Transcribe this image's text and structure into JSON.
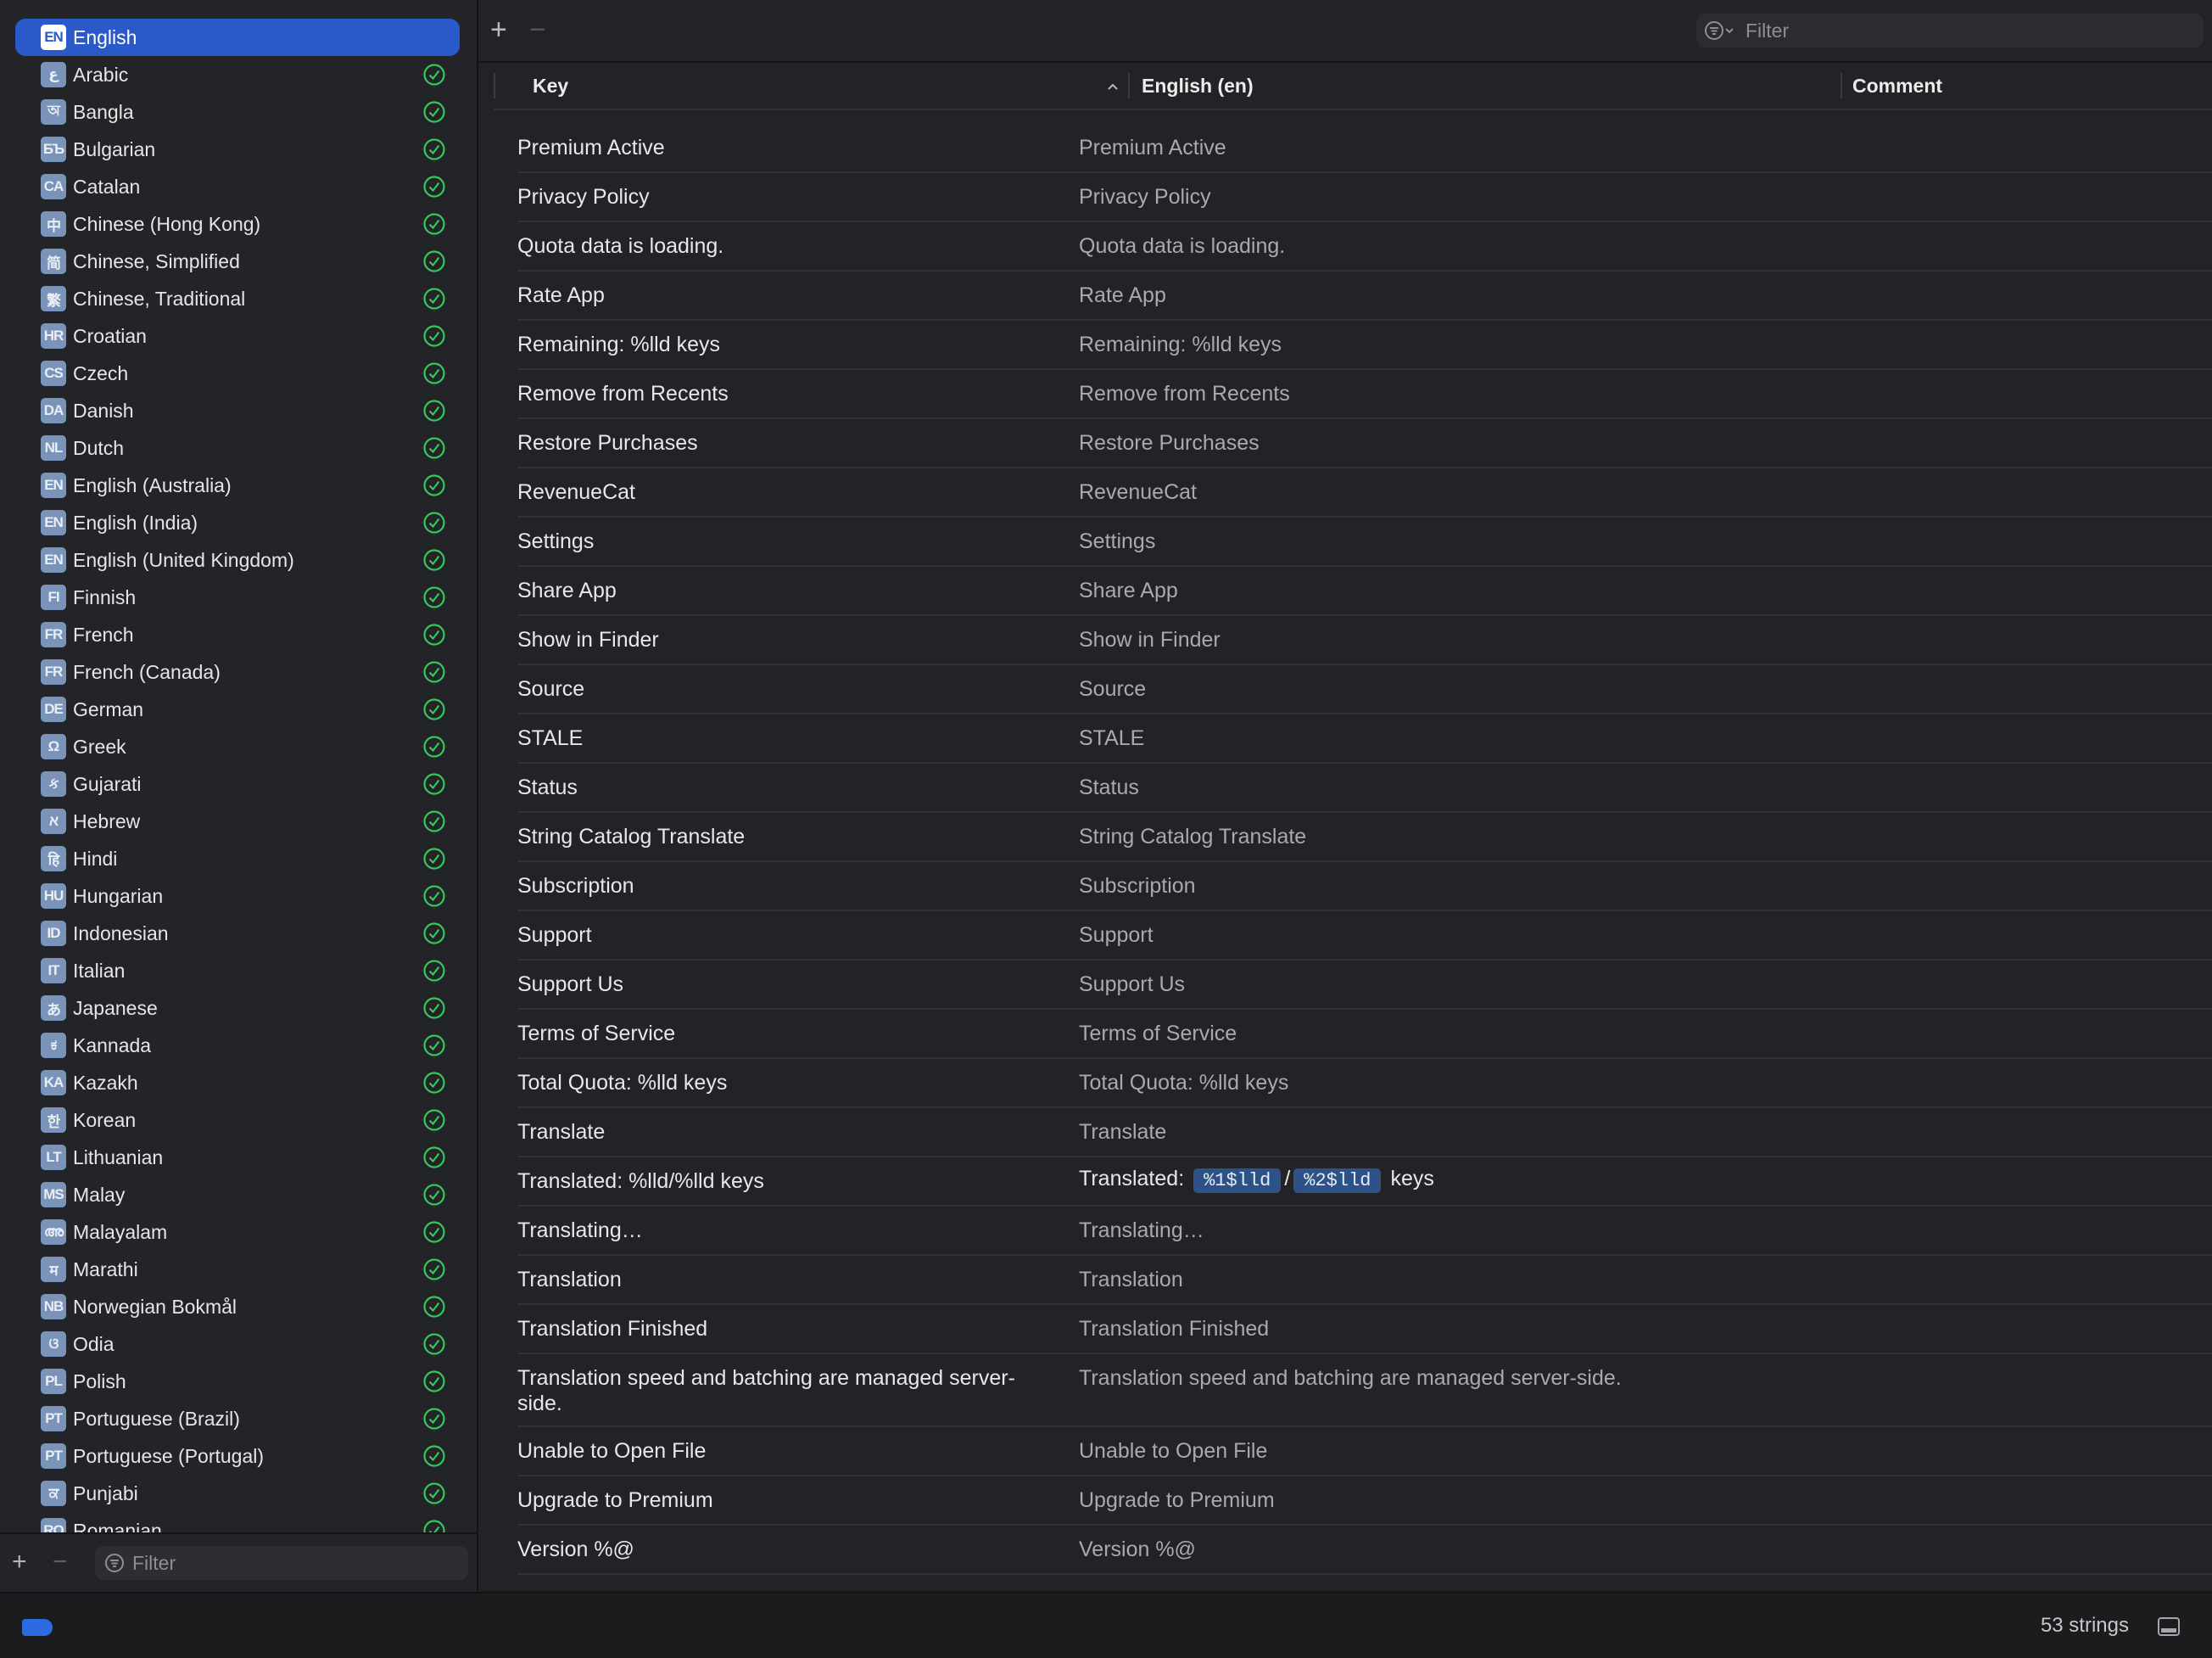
{
  "sidebar": {
    "languages": [
      {
        "code": "EN",
        "name": "English",
        "selected": true,
        "complete": false
      },
      {
        "code": "ع",
        "name": "Arabic",
        "complete": true
      },
      {
        "code": "অ",
        "name": "Bangla",
        "complete": true
      },
      {
        "code": "БЪ",
        "name": "Bulgarian",
        "complete": true
      },
      {
        "code": "CA",
        "name": "Catalan",
        "complete": true
      },
      {
        "code": "中",
        "name": "Chinese (Hong Kong)",
        "complete": true
      },
      {
        "code": "简",
        "name": "Chinese, Simplified",
        "complete": true
      },
      {
        "code": "繁",
        "name": "Chinese, Traditional",
        "complete": true
      },
      {
        "code": "HR",
        "name": "Croatian",
        "complete": true
      },
      {
        "code": "CS",
        "name": "Czech",
        "complete": true
      },
      {
        "code": "DA",
        "name": "Danish",
        "complete": true
      },
      {
        "code": "NL",
        "name": "Dutch",
        "complete": true
      },
      {
        "code": "EN",
        "name": "English (Australia)",
        "complete": true
      },
      {
        "code": "EN",
        "name": "English (India)",
        "complete": true
      },
      {
        "code": "EN",
        "name": "English (United Kingdom)",
        "complete": true
      },
      {
        "code": "FI",
        "name": "Finnish",
        "complete": true
      },
      {
        "code": "FR",
        "name": "French",
        "complete": true
      },
      {
        "code": "FR",
        "name": "French (Canada)",
        "complete": true
      },
      {
        "code": "DE",
        "name": "German",
        "complete": true
      },
      {
        "code": "Ω",
        "name": "Greek",
        "complete": true
      },
      {
        "code": "ક",
        "name": "Gujarati",
        "complete": true
      },
      {
        "code": "א",
        "name": "Hebrew",
        "complete": true
      },
      {
        "code": "हि",
        "name": "Hindi",
        "complete": true
      },
      {
        "code": "HU",
        "name": "Hungarian",
        "complete": true
      },
      {
        "code": "ID",
        "name": "Indonesian",
        "complete": true
      },
      {
        "code": "IT",
        "name": "Italian",
        "complete": true
      },
      {
        "code": "あ",
        "name": "Japanese",
        "complete": true
      },
      {
        "code": "ಕ",
        "name": "Kannada",
        "complete": true
      },
      {
        "code": "KA",
        "name": "Kazakh",
        "complete": true
      },
      {
        "code": "한",
        "name": "Korean",
        "complete": true
      },
      {
        "code": "LT",
        "name": "Lithuanian",
        "complete": true
      },
      {
        "code": "MS",
        "name": "Malay",
        "complete": true
      },
      {
        "code": "അ",
        "name": "Malayalam",
        "complete": true
      },
      {
        "code": "म",
        "name": "Marathi",
        "complete": true
      },
      {
        "code": "NB",
        "name": "Norwegian Bokmål",
        "complete": true
      },
      {
        "code": "ଓ",
        "name": "Odia",
        "complete": true
      },
      {
        "code": "PL",
        "name": "Polish",
        "complete": true
      },
      {
        "code": "PT",
        "name": "Portuguese (Brazil)",
        "complete": true
      },
      {
        "code": "PT",
        "name": "Portuguese (Portugal)",
        "complete": true
      },
      {
        "code": "ਕ",
        "name": "Punjabi",
        "complete": true
      },
      {
        "code": "RO",
        "name": "Romanian",
        "complete": true
      }
    ],
    "add_label": "+",
    "remove_label": "−",
    "filter_placeholder": "Filter"
  },
  "toolbar": {
    "add_label": "+",
    "remove_label": "−",
    "filter_placeholder": "Filter"
  },
  "table": {
    "columns": {
      "key": "Key",
      "value": "English (en)",
      "comment": "Comment"
    },
    "rows": [
      {
        "key": "Premium Active",
        "value": "Premium Active"
      },
      {
        "key": "Privacy Policy",
        "value": "Privacy Policy"
      },
      {
        "key": "Quota data is loading.",
        "value": "Quota data is loading."
      },
      {
        "key": "Rate App",
        "value": "Rate App"
      },
      {
        "key": "Remaining: %lld keys",
        "value": "Remaining: %lld keys"
      },
      {
        "key": "Remove from Recents",
        "value": "Remove from Recents"
      },
      {
        "key": "Restore Purchases",
        "value": "Restore Purchases"
      },
      {
        "key": "RevenueCat",
        "value": "RevenueCat"
      },
      {
        "key": "Settings",
        "value": "Settings"
      },
      {
        "key": "Share App",
        "value": "Share App"
      },
      {
        "key": "Show in Finder",
        "value": "Show in Finder"
      },
      {
        "key": "Source",
        "value": "Source"
      },
      {
        "key": "STALE",
        "value": "STALE"
      },
      {
        "key": "Status",
        "value": "Status"
      },
      {
        "key": "String Catalog Translate",
        "value": "String Catalog Translate"
      },
      {
        "key": "Subscription",
        "value": "Subscription"
      },
      {
        "key": "Support",
        "value": "Support"
      },
      {
        "key": "Support Us",
        "value": "Support Us"
      },
      {
        "key": "Terms of Service",
        "value": "Terms of Service"
      },
      {
        "key": "Total Quota: %lld keys",
        "value": "Total Quota: %lld keys"
      },
      {
        "key": "Translate",
        "value": "Translate"
      },
      {
        "key": "Translated: %lld/%lld keys",
        "value_parts": {
          "prefix": "Translated:",
          "arg1": "%1$lld",
          "sep": "/",
          "arg2": "%2$lld",
          "suffix": "keys"
        }
      },
      {
        "key": "Translating…",
        "value": "Translating…"
      },
      {
        "key": "Translation",
        "value": "Translation"
      },
      {
        "key": "Translation Finished",
        "value": "Translation Finished"
      },
      {
        "key_line1": "Translation speed and batching are managed server-",
        "key_line2": "side.",
        "value": "Translation speed and batching are managed server-side."
      },
      {
        "key": "Unable to Open File",
        "value": "Unable to Open File"
      },
      {
        "key": "Upgrade to Premium",
        "value": "Upgrade to Premium"
      },
      {
        "key": "Version %@",
        "value": "Version %@"
      }
    ]
  },
  "status": {
    "count_label": "53 strings"
  },
  "colors": {
    "accent": "#2a5ac9",
    "check": "#34c759",
    "placeholder_tag": "#2c5287"
  }
}
